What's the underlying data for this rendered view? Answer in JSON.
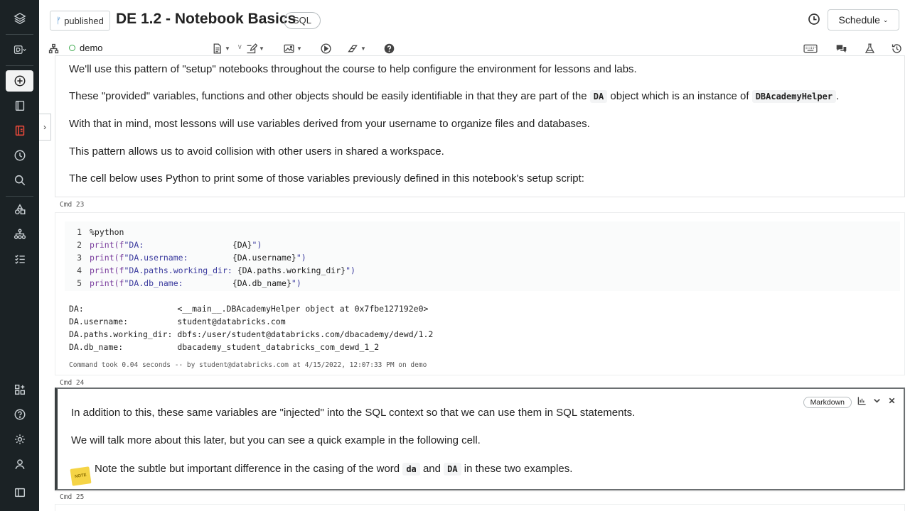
{
  "header": {
    "published_label": "published",
    "notebook_title": "DE 1.2 - Notebook Basics",
    "language": "SQL",
    "schedule_label": "Schedule"
  },
  "toolbar": {
    "cluster_name": "demo"
  },
  "cells": {
    "md1": {
      "lines": [
        "We'll use this pattern of \"setup\" notebooks throughout the course to help configure the environment for lessons and labs.",
        "These \"provided\" variables, functions and other objects should be easily identifiable in that they are part of the",
        "object which is an instance of",
        "With that in mind, most lessons will use variables derived from your username to organize files and databases.",
        "This pattern allows us to avoid collision with other users in shared a workspace.",
        "The cell below uses Python to print some of those variables previously defined in this notebook's setup script:"
      ],
      "code_da": "DA",
      "code_helper": "DBAcademyHelper",
      "period": "."
    },
    "cmd23": {
      "label": "Cmd 23",
      "line_numbers": [
        "1",
        "2",
        "3",
        "4",
        "5"
      ],
      "magic": "%python",
      "code": [
        {
          "fn": "print",
          "open": "(f",
          "str": "\"DA:                  ",
          "expr": "{DA}",
          "close": "\")"
        },
        {
          "fn": "print",
          "open": "(f",
          "str": "\"DA.username:         ",
          "expr": "{DA.username}",
          "close": "\")"
        },
        {
          "fn": "print",
          "open": "(f",
          "str": "\"DA.paths.working_dir: ",
          "expr": "{DA.paths.working_dir}",
          "close": "\")"
        },
        {
          "fn": "print",
          "open": "(f",
          "str": "\"DA.db_name:          ",
          "expr": "{DA.db_name}",
          "close": "\")"
        }
      ],
      "output": [
        "DA:                   <__main__.DBAcademyHelper object at 0x7fbe127192e0>",
        "DA.username:          student@databricks.com",
        "DA.paths.working_dir: dbfs:/user/student@databricks.com/dbacademy/dewd/1.2",
        "DA.db_name:           dbacademy_student_databricks_com_dewd_1_2"
      ],
      "took": "Command took 0.04 seconds -- by student@databricks.com at 4/15/2022, 12:07:33 PM on demo"
    },
    "cmd24": {
      "label": "Cmd 24",
      "type_label": "Markdown",
      "lines": [
        "In addition to this, these same variables are \"injected\" into the SQL context so that we can use them in SQL statements.",
        "We will talk more about this later, but you can see a quick example in the following cell.",
        "Note the subtle but important difference in the casing of the word",
        "and",
        "in these two examples."
      ],
      "code_lower": "da",
      "code_upper": "DA",
      "note_icon_text": "NOTE"
    },
    "cmd25": {
      "label": "Cmd 25"
    }
  }
}
